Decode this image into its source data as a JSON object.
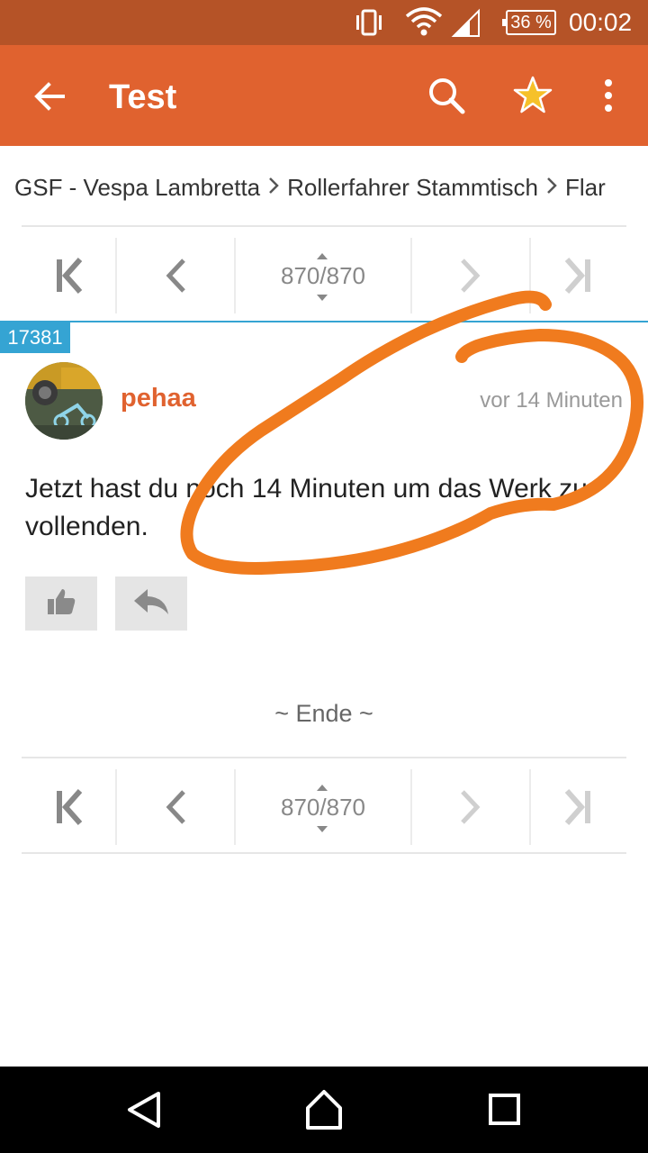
{
  "status_bar": {
    "icons": [
      "vibrate-icon",
      "wifi-icon",
      "signal-icon"
    ],
    "battery": "36 %",
    "time": "00:02"
  },
  "app_bar": {
    "title": "Test",
    "icons": [
      "back-arrow-icon",
      "search-icon",
      "star-icon",
      "more-vert-icon"
    ],
    "colors": {
      "bar": "#e0622f",
      "star": "#f6c129",
      "status": "#b55327"
    }
  },
  "breadcrumb": {
    "items": [
      "GSF - Vespa Lambretta",
      "Rollerfahrer Stammtisch",
      "Flar"
    ]
  },
  "pager_top": {
    "count": "870/870",
    "icons": [
      "first-page-icon",
      "prev-page-icon",
      "next-page-icon",
      "last-page-icon"
    ]
  },
  "post": {
    "number": "17381",
    "author": "pehaa",
    "time": "vor 14 Minuten",
    "body": "Jetzt hast du noch 14 Minuten um das Werk zu vollenden.",
    "actions": [
      "thumbs-up-icon",
      "reply-icon"
    ],
    "colors": {
      "number_badge": "#35a4d3",
      "author": "#e0622f"
    }
  },
  "end_marker": "~ Ende ~",
  "pager_bottom": {
    "count": "870/870",
    "icons": [
      "first-page-icon",
      "prev-page-icon",
      "next-page-icon",
      "last-page-icon"
    ]
  },
  "annotation": {
    "type": "hand-drawn-circle",
    "color": "#f07b1e"
  },
  "nav_bar": {
    "icons": [
      "back-triangle-icon",
      "home-icon",
      "recents-icon"
    ]
  }
}
